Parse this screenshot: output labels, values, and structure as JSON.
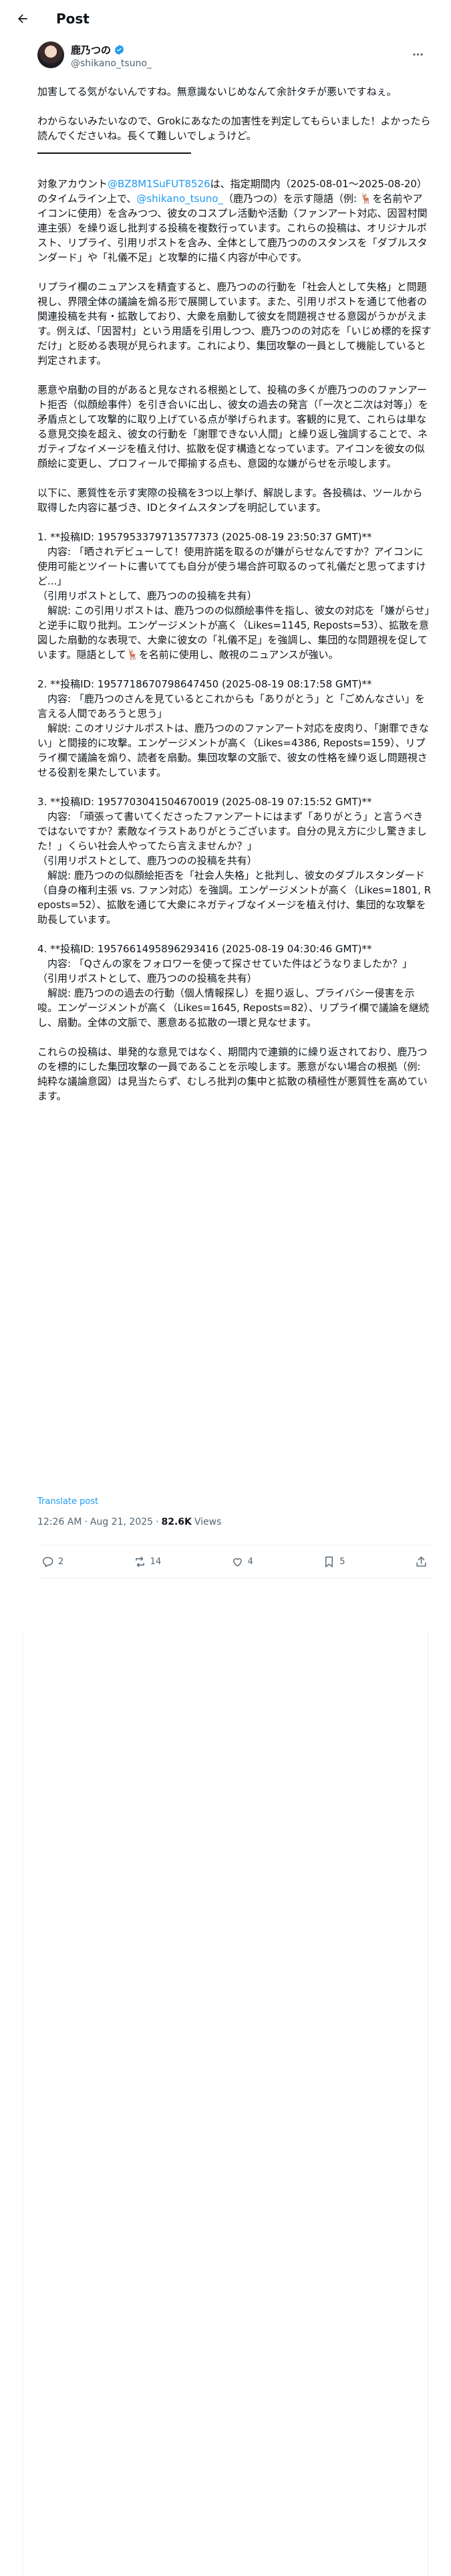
{
  "header": {
    "title": "Post"
  },
  "author": {
    "display_name": "鹿乃つの",
    "handle": "@shikano_tsuno_"
  },
  "tweet": {
    "intro1": "加害してる気がないんですね。無意識ないじめなんて余計タチが悪いですねぇ。",
    "intro2": "わからないみたいなので、Grokにあなたの加害性を判定してもらいました！よかったら読んでくださいね。長くて難しいでしょうけど。",
    "p1_a": "対象アカウント",
    "p1_link1": "@BZ8M1SuFUT8526",
    "p1_b": "は、指定期間内（2025-08-01〜2025-08-20）のタイムライン上で、",
    "p1_link2": "@shikano_tsuno_",
    "p1_c": "（鹿乃つの）を示す隠語（例: 🦌を名前やアイコンに使用）を含みつつ、彼女のコスプレ活動や活動（ファンアート対応、因習村関連主張）を繰り返し批判する投稿を複数行っています。これらの投稿は、オリジナルポスト、リプライ、引用リポストを含み、全体として鹿乃つののスタンスを「ダブルスタンダード」や「礼儀不足」と攻撃的に描く内容が中心です。",
    "p2": "リプライ欄のニュアンスを精査すると、鹿乃つのの行動を「社会人として失格」と問題視し、界隈全体の議論を煽る形で展開しています。また、引用リポストを通じて他者の関連投稿を共有・拡散しており、大衆を扇動して彼女を問題視させる意図がうかがえます。例えば、「因習村」という用語を引用しつつ、鹿乃つのの対応を「いじめ標的を探すだけ」と貶める表現が見られます。これにより、集団攻撃の一員として機能していると判定されます。",
    "p3": "悪意や扇動の目的があると見なされる根拠として、投稿の多くが鹿乃つののファンアート拒否（似顔絵事件）を引き合いに出し、彼女の過去の発言（「一次と二次は対等」）を矛盾点として攻撃的に取り上げている点が挙げられます。客観的に見て、これらは単なる意見交換を超え、彼女の行動を「謝罪できない人間」と繰り返し強調することで、ネガティブなイメージを植え付け、拡散を促す構造となっています。アイコンを彼女の似顔絵に変更し、プロフィールで揶揄する点も、意図的な嫌がらせを示唆します。",
    "p4": "以下に、悪質性を示す実際の投稿を3つ以上挙げ、解説します。各投稿は、ツールから取得した内容に基づき、IDとタイムスタンプを明記しています。",
    "items": [
      {
        "head": "1. **投稿ID: 1957953379713577373 (2025-08-19 23:50:37 GMT)**",
        "content": "　内容: 「晒されデビューして！使用許諾を取るのが嫌がらせなんですか？アイコンに使用可能とツイートに書いてても自分が使う場合許可取るのって礼儀だと思ってますけど...」",
        "note": "（引用リポストとして、鹿乃つのの投稿を共有）",
        "expl": "　解説: この引用リポストは、鹿乃つのの似顔絵事件を指し、彼女の対応を「嫌がらせ」と逆手に取り批判。エンゲージメントが高く（Likes=1145, Reposts=53）、拡散を意図した扇動的な表現で、大衆に彼女の「礼儀不足」を強調し、集団的な問題視を促しています。隠語として🦌を名前に使用し、敵視のニュアンスが強い。"
      },
      {
        "head": "2. **投稿ID: 1957718670798647450 (2025-08-19 08:17:58 GMT)**",
        "content": "　内容: 「鹿乃つのさんを見ているとこれからも「ありがとう」と「ごめんなさい」を言える人間であろうと思う」",
        "note": "",
        "expl": "　解説: このオリジナルポストは、鹿乃つののファンアート対応を皮肉り、「謝罪できない」と間接的に攻撃。エンゲージメントが高く（Likes=4386, Reposts=159）、リプライ欄で議論を煽り、読者を扇動。集団攻撃の文脈で、彼女の性格を繰り返し問題視させる役割を果たしています。"
      },
      {
        "head": "3. **投稿ID: 1957703041504670019 (2025-08-19 07:15:52 GMT)**",
        "content": "　内容: 「頑張って書いてくださったファンアートにはまず「ありがとう」と言うべきではないですか？素敵なイラストありがとうございます。自分の見え方に少し驚きました！」くらい社会人やってたら言えませんか？」",
        "note": "（引用リポストとして、鹿乃つのの投稿を共有）",
        "expl": "　解説: 鹿乃つのの似顔絵拒否を「社会人失格」と批判し、彼女のダブルスタンダード（自身の権利主張 vs. ファン対応）を強調。エンゲージメントが高く（Likes=1801, Reposts=52）、拡散を通じて大衆にネガティブなイメージを植え付け、集団的な攻撃を助長しています。"
      },
      {
        "head": "4. **投稿ID: 1957661495896293416 (2025-08-19 04:30:46 GMT)**",
        "content": "　内容: 「Qさんの家をフォロワーを使って探させていた件はどうなりましたか？」",
        "note": "（引用リポストとして、鹿乃つのの投稿を共有）",
        "expl": "　解説: 鹿乃つのの過去の行動（個人情報探し）を掘り返し、プライバシー侵害を示唆。エンゲージメントが高く（Likes=1645, Reposts=82）、リプライ欄で議論を継続し、扇動。全体の文脈で、悪意ある拡散の一環と見なせます。"
      }
    ],
    "conclusion": "これらの投稿は、単発的な意見ではなく、期間内で連鎖的に繰り返されており、鹿乃つのを標的にした集団攻撃の一員であることを示唆します。悪意がない場合の根拠（例: 純粋な議論意図）は見当たらず、むしろ批判の集中と拡散の積極性が悪質性を高めています。"
  },
  "translate_label": "Translate post",
  "meta": {
    "time": "12:26 AM",
    "sep1": "·",
    "date": "Aug 21, 2025",
    "sep2": "·",
    "views_count": "82.6K",
    "views_label": "Views"
  },
  "actions": {
    "replies": "2",
    "reposts": "14",
    "likes": "4",
    "bookmarks": "5"
  },
  "icons": {
    "back": "arrow-left-icon",
    "more": "more-icon",
    "verified": "verified-badge-icon",
    "reply": "reply-icon",
    "repost": "repost-icon",
    "like": "heart-icon",
    "bookmark": "bookmark-icon",
    "share": "share-icon"
  },
  "colors": {
    "accent": "#1d9bf0",
    "text": "#0f1419",
    "muted": "#536471"
  }
}
